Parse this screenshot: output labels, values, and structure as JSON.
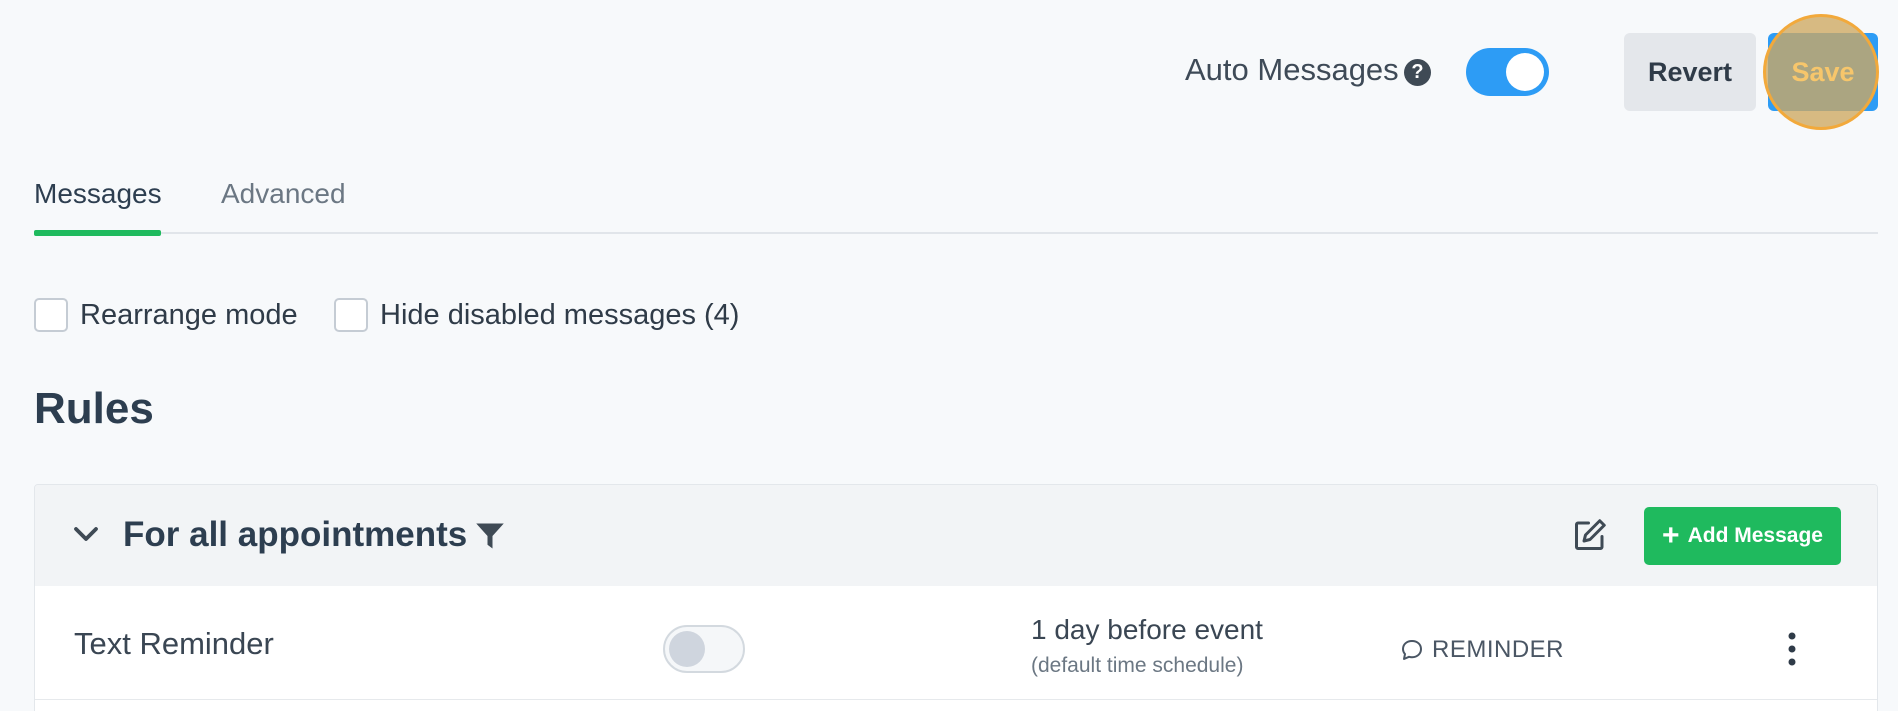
{
  "header": {
    "auto_messages_label": "Auto Messages",
    "help_glyph": "?",
    "auto_messages_enabled": true,
    "revert_label": "Revert",
    "save_label": "Save"
  },
  "tabs": [
    {
      "label": "Messages",
      "active": true
    },
    {
      "label": "Advanced",
      "active": false
    }
  ],
  "options": {
    "rearrange_label": "Rearrange mode",
    "hide_disabled_label": "Hide disabled messages (4)"
  },
  "rules": {
    "title": "Rules",
    "group": {
      "title": "For all appointments",
      "add_message_label": "Add Message",
      "messages": [
        {
          "name": "Text Reminder",
          "enabled": false,
          "timing": "1 day before event",
          "schedule": "(default time schedule)",
          "type": "REMINDER"
        }
      ]
    }
  },
  "colors": {
    "primary": "#2d9cf5",
    "success": "#1fba5e",
    "highlight": "#f2a93b"
  },
  "icons": [
    "help-icon",
    "chevron-down-icon",
    "filter-icon",
    "edit-icon",
    "plus-icon",
    "chat-bubble-icon",
    "more-vertical-icon"
  ]
}
